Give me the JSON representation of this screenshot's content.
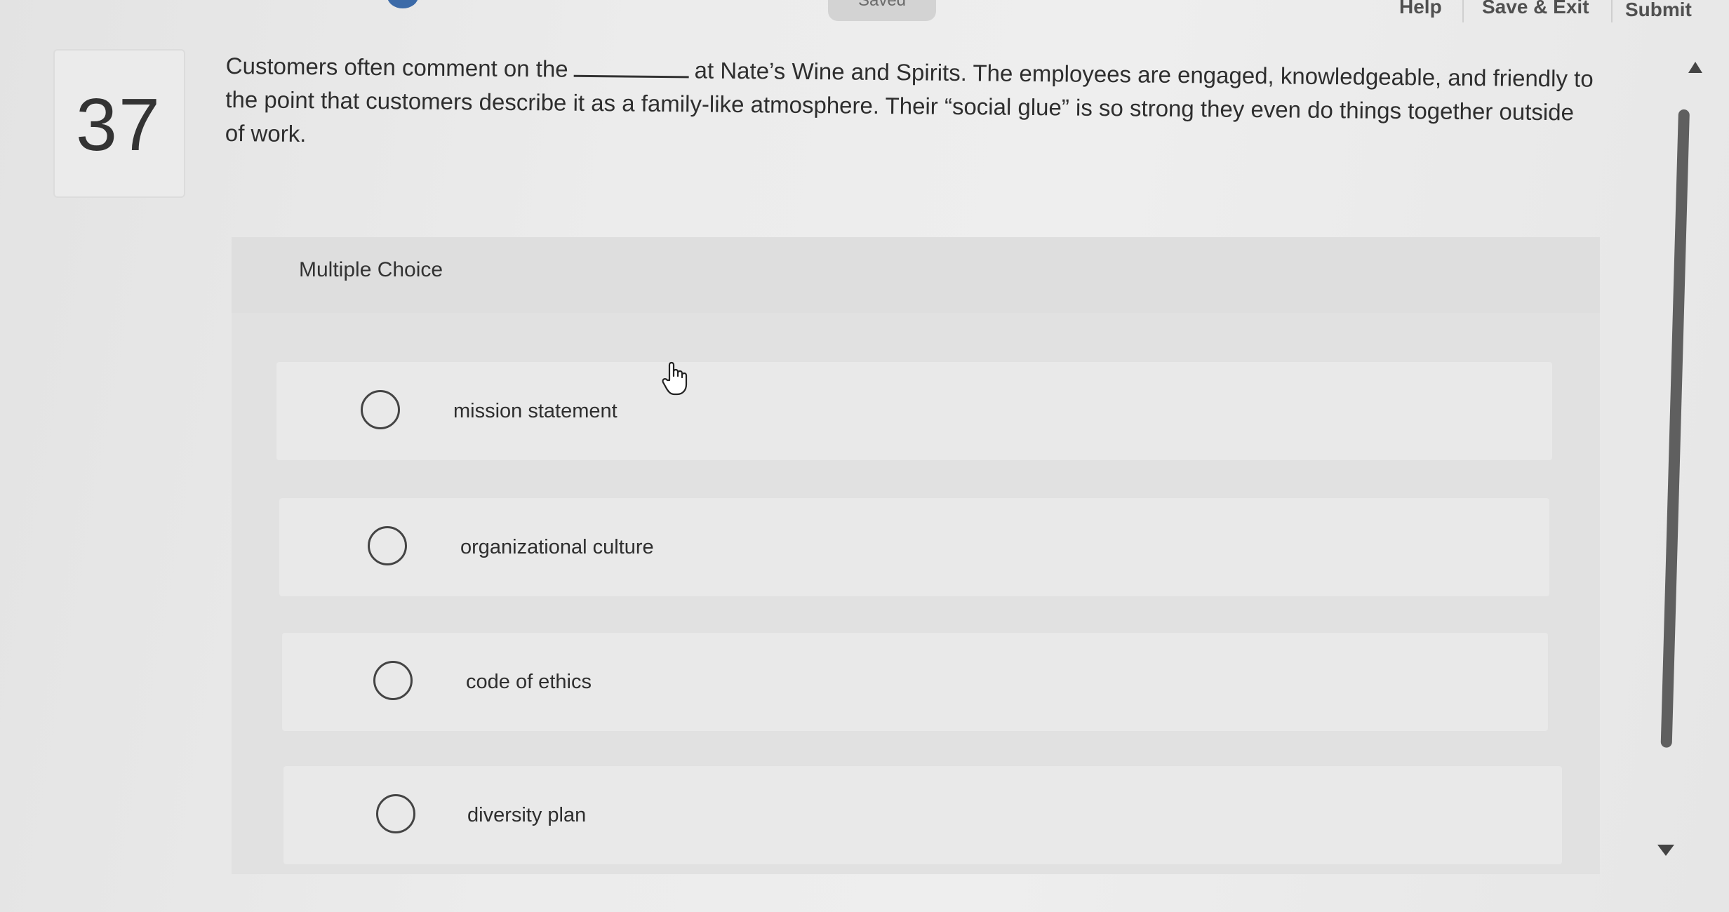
{
  "topbar": {
    "saved_label": "Saved",
    "help_label": "Help",
    "save_exit_label": "Save & Exit",
    "submit_label": "Submit"
  },
  "question": {
    "number": "37",
    "text_before_blank": "Customers often comment on the",
    "text_after_blank": "at Nate’s Wine and Spirits. The employees are engaged, knowledgeable, and friendly to the point that customers describe it as a family-like atmosphere. Their “social glue” is so strong they even do things together outside of work."
  },
  "multiple_choice": {
    "title": "Multiple Choice",
    "options": [
      {
        "label": "mission statement"
      },
      {
        "label": "organizational culture"
      },
      {
        "label": "code of ethics"
      },
      {
        "label": "diversity plan"
      }
    ]
  },
  "colors": {
    "background": "#e9e9e9",
    "panel": "#e1e1e1",
    "choice_row": "#e9e9e9",
    "text": "#2e2e2e",
    "scrollbar": "#5f5f5f"
  },
  "icons": [
    "hand-pointer-icon",
    "radio-unselected-icon",
    "scroll-up-arrow-icon",
    "scroll-down-arrow-icon"
  ]
}
